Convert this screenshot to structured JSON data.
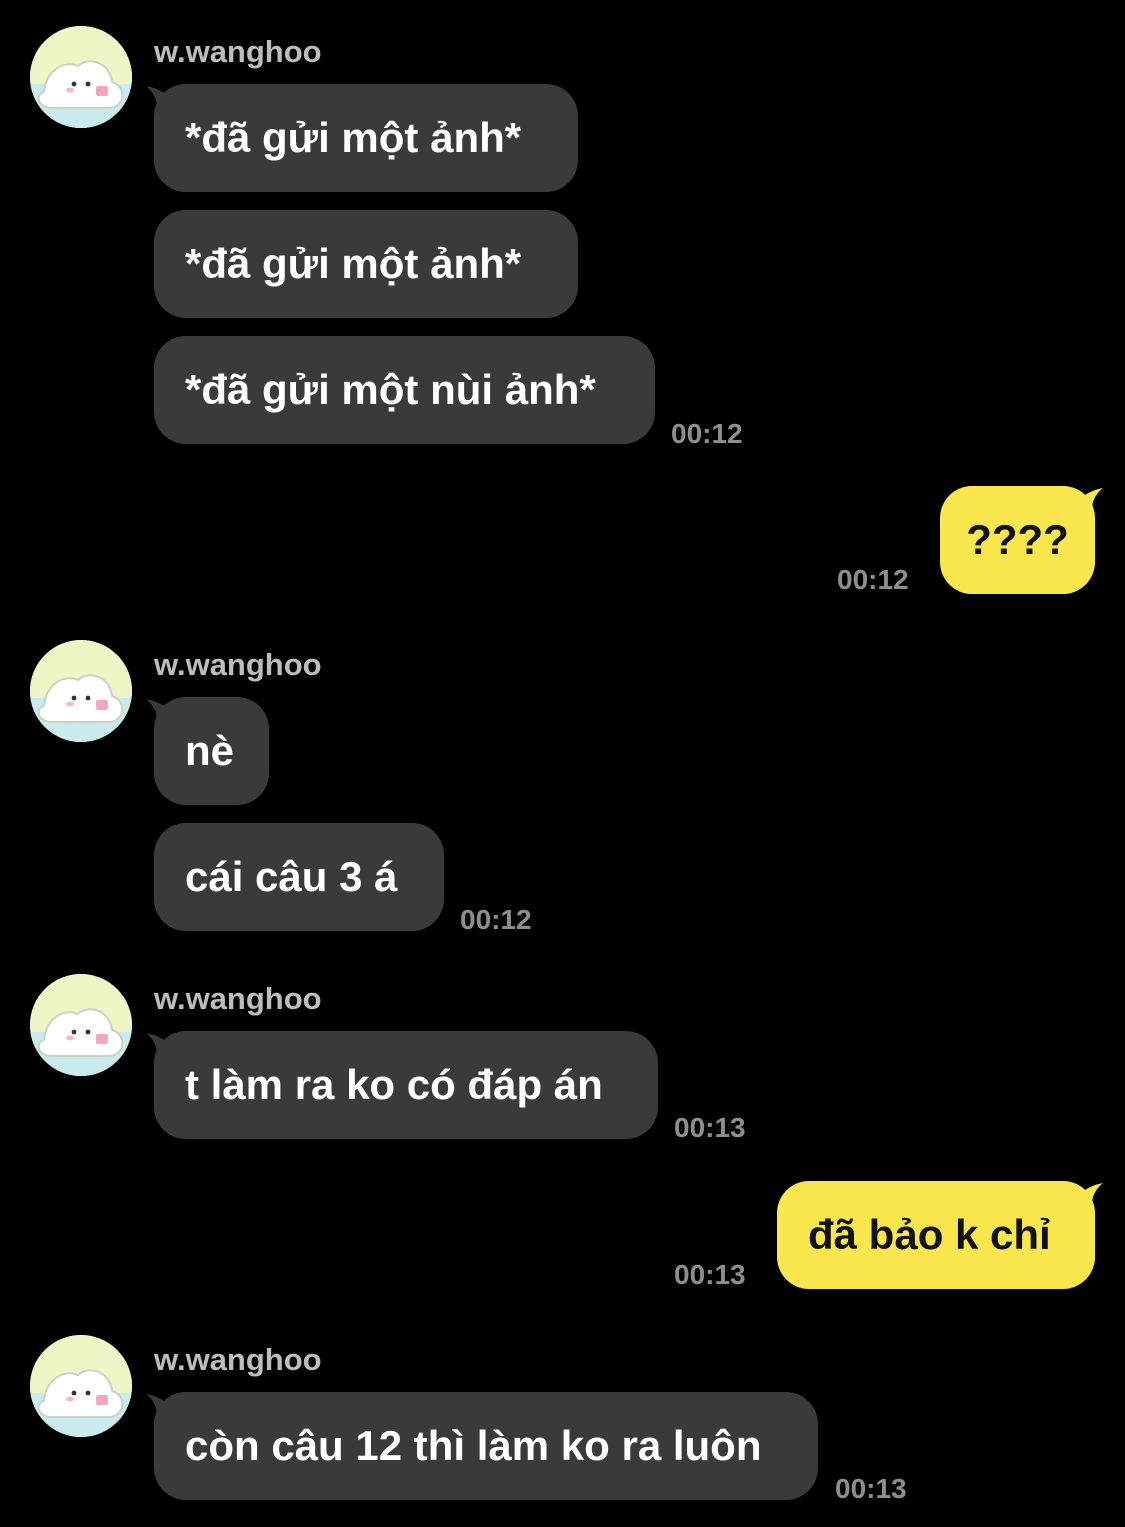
{
  "contact": {
    "name": "w.wanghoo",
    "avatar_icon": "cartoon-avatar-icon"
  },
  "colors": {
    "background": "#000000",
    "incoming_bubble": "#3a3a3c",
    "outgoing_bubble": "#fae64d",
    "timestamp": "#8e8e8e"
  },
  "groups": [
    {
      "sender": "w.wanghoo",
      "messages": [
        "*đã gửi một ảnh*",
        "*đã gửi một ảnh*",
        "*đã gửi một nùi ảnh*"
      ],
      "time": "00:12"
    },
    {
      "sender": "me",
      "messages": [
        "????"
      ],
      "time": "00:12"
    },
    {
      "sender": "w.wanghoo",
      "messages": [
        "nè",
        "cái câu 3 á"
      ],
      "time": "00:12"
    },
    {
      "sender": "w.wanghoo",
      "messages": [
        "t làm ra ko có đáp án"
      ],
      "time": "00:13"
    },
    {
      "sender": "me",
      "messages": [
        "đã bảo k chỉ"
      ],
      "time": "00:13"
    },
    {
      "sender": "w.wanghoo",
      "messages": [
        "còn câu 12 thì làm ko ra luôn"
      ],
      "time": "00:13"
    }
  ]
}
